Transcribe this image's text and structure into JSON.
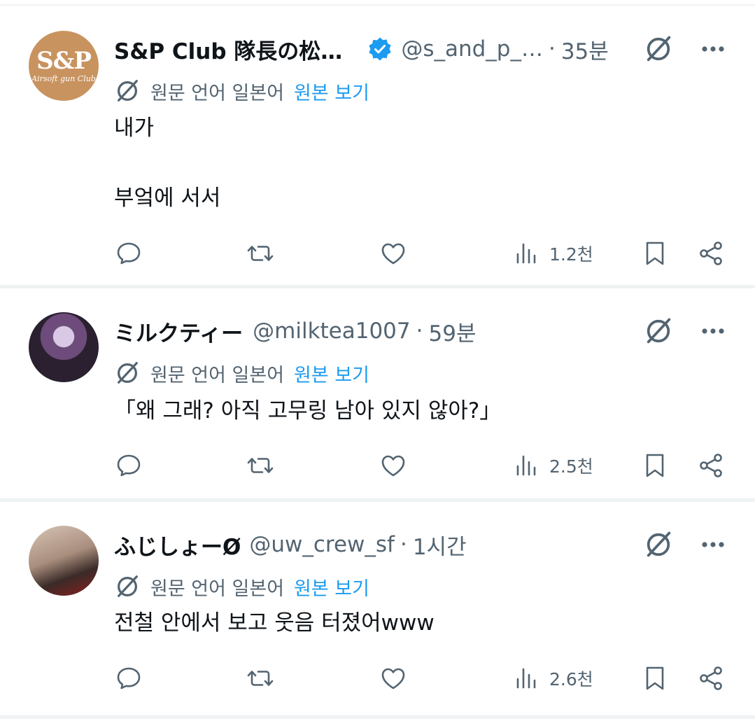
{
  "posts": [
    {
      "name": "S&P Club 隊長の松…",
      "verified": true,
      "handle": "@s_and_p_…",
      "time": "35분",
      "avatar": {
        "logo": "S&P",
        "sub": "Airsoft gun Club",
        "color": "#c8935f"
      },
      "translation": {
        "lang": "원문 언어 일본어",
        "link": "원본 보기"
      },
      "lines": [
        "내가",
        "",
        "부엌에 서서"
      ],
      "views": "1.2천"
    },
    {
      "name": "ミルクティー",
      "verified": false,
      "handle": "@milktea1007",
      "time": "59분",
      "translation": {
        "lang": "원문 언어 일본어",
        "link": "원본 보기"
      },
      "lines": [
        "「왜 그래? 아직 고무링 남아 있지 않아?」"
      ],
      "views": "2.5천"
    },
    {
      "name": "ふじしょーØ",
      "verified": false,
      "handle": "@uw_crew_sf",
      "time": "1시간",
      "translation": {
        "lang": "원문 언어 일본어",
        "link": "원본 보기"
      },
      "lines": [
        "전철 안에서 보고 웃음 터졌어www"
      ],
      "views": "2.6천"
    }
  ],
  "icons": {
    "grok": "grok-icon",
    "more": "more-icon",
    "reply": "reply-icon",
    "retweet": "retweet-icon",
    "like": "like-icon",
    "views": "views-icon",
    "bookmark": "bookmark-icon",
    "share": "share-icon",
    "verified": "verified-badge-icon"
  },
  "colors": {
    "link": "#1d9bf0",
    "secondary": "#536471",
    "text": "#0f1419",
    "verified": "#1d9bf0"
  }
}
